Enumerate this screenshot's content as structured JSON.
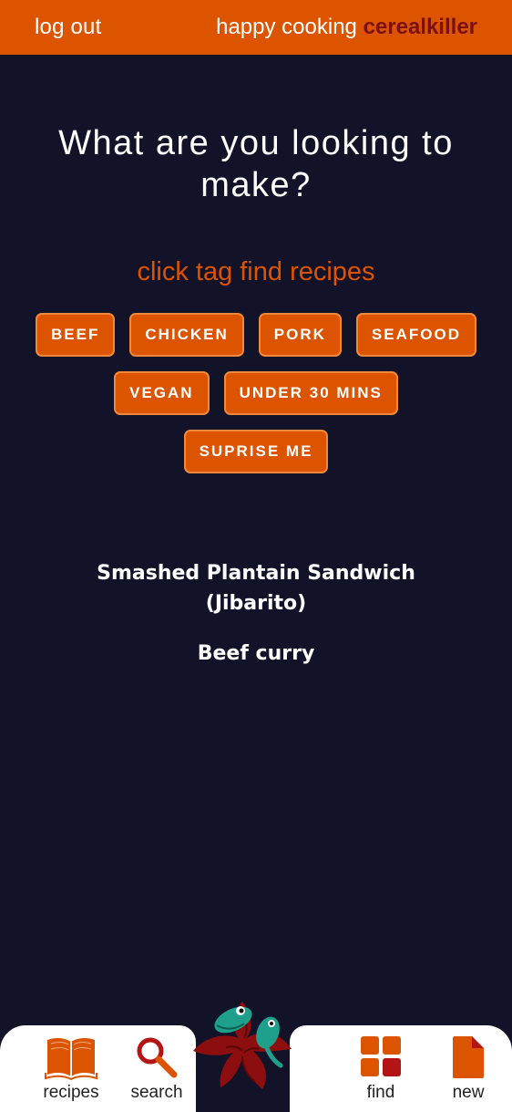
{
  "header": {
    "logout_label": "log out",
    "greeting": "happy cooking",
    "username": "cerealkiller"
  },
  "main": {
    "headline": "What are you looking to make?",
    "subheadline": "click tag find recipes",
    "tag_rows": [
      [
        "BEEF",
        "CHICKEN",
        "PORK",
        "SEAFOOD"
      ],
      [
        "VEGAN",
        "UNDER 30 MINS"
      ],
      [
        "SUPRISE ME"
      ]
    ],
    "results": [
      "Smashed Plantain Sandwich (Jibarito)",
      "Beef curry"
    ]
  },
  "bottom_nav": {
    "items": [
      {
        "label": "recipes",
        "icon": "book-icon"
      },
      {
        "label": "search",
        "icon": "search-icon"
      },
      {
        "label": "find",
        "icon": "grid-icon"
      },
      {
        "label": "new",
        "icon": "document-icon"
      }
    ],
    "center_icon": "mascot-logo"
  },
  "colors": {
    "accent": "#DD5400",
    "background": "#121229",
    "username": "#7A1010"
  }
}
